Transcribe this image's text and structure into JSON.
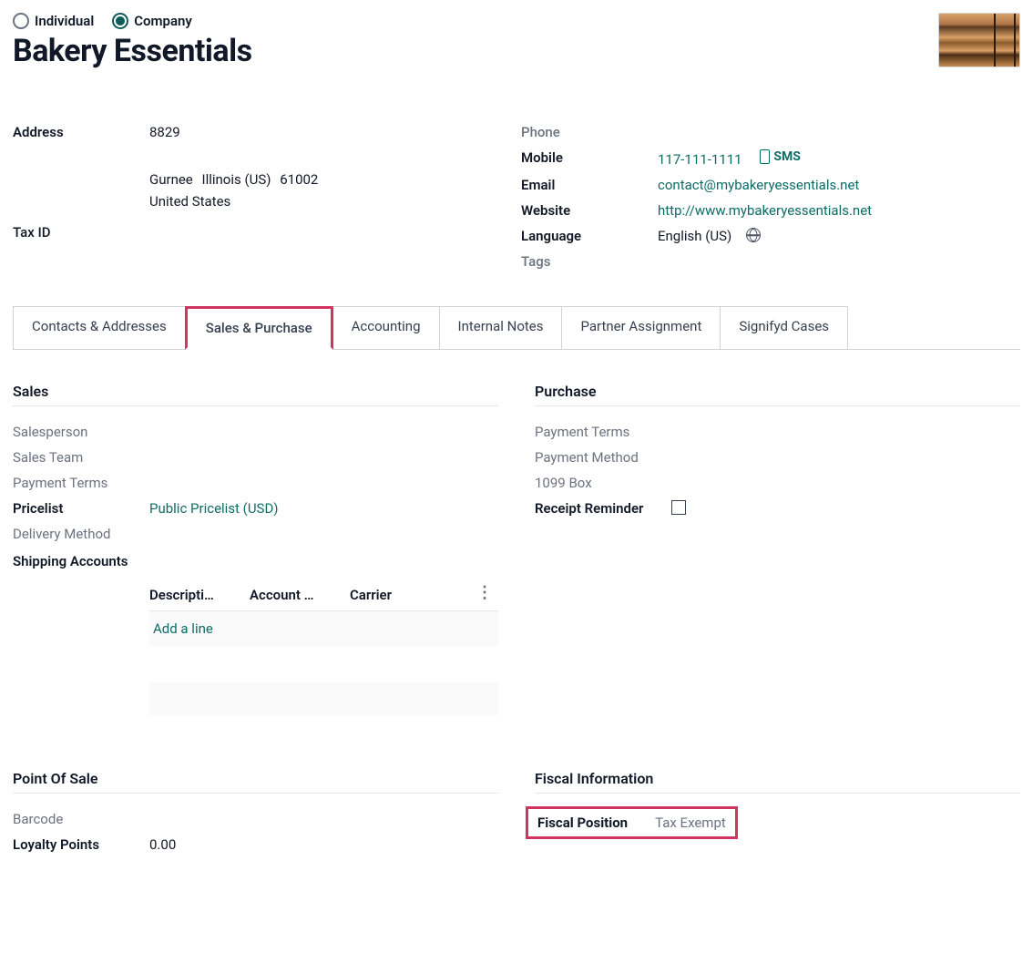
{
  "header": {
    "type_options": {
      "individual": "Individual",
      "company": "Company"
    },
    "selected_type": "company",
    "title": "Bakery Essentials"
  },
  "left_info": {
    "address_label": "Address",
    "street": "8829",
    "city": "Gurnee",
    "state": "Illinois (US)",
    "zip": "61002",
    "country": "United States",
    "tax_id_label": "Tax ID"
  },
  "right_info": {
    "phone_label": "Phone",
    "mobile_label": "Mobile",
    "mobile_value": "117-111-1111",
    "sms_label": "SMS",
    "email_label": "Email",
    "email_value": "contact@mybakeryessentials.net",
    "website_label": "Website",
    "website_value": "http://www.mybakeryessentials.net",
    "language_label": "Language",
    "language_value": "English (US)",
    "tags_label": "Tags"
  },
  "tabs": [
    "Contacts & Addresses",
    "Sales & Purchase",
    "Accounting",
    "Internal Notes",
    "Partner Assignment",
    "Signifyd Cases"
  ],
  "active_tab": 1,
  "sales": {
    "title": "Sales",
    "salesperson_label": "Salesperson",
    "sales_team_label": "Sales Team",
    "payment_terms_label": "Payment Terms",
    "pricelist_label": "Pricelist",
    "pricelist_value": "Public Pricelist (USD)",
    "delivery_method_label": "Delivery Method",
    "shipping_accounts_label": "Shipping Accounts",
    "ship_cols": {
      "desc": "Descripti…",
      "acct": "Account …",
      "carrier": "Carrier"
    },
    "add_line": "Add a line"
  },
  "purchase": {
    "title": "Purchase",
    "payment_terms_label": "Payment Terms",
    "payment_method_label": "Payment Method",
    "box_1099_label": "1099 Box",
    "receipt_reminder_label": "Receipt Reminder"
  },
  "pos": {
    "title": "Point Of Sale",
    "barcode_label": "Barcode",
    "loyalty_label": "Loyalty Points",
    "loyalty_value": "0.00"
  },
  "fiscal": {
    "title": "Fiscal Information",
    "position_label": "Fiscal Position",
    "position_value": "Tax Exempt"
  }
}
